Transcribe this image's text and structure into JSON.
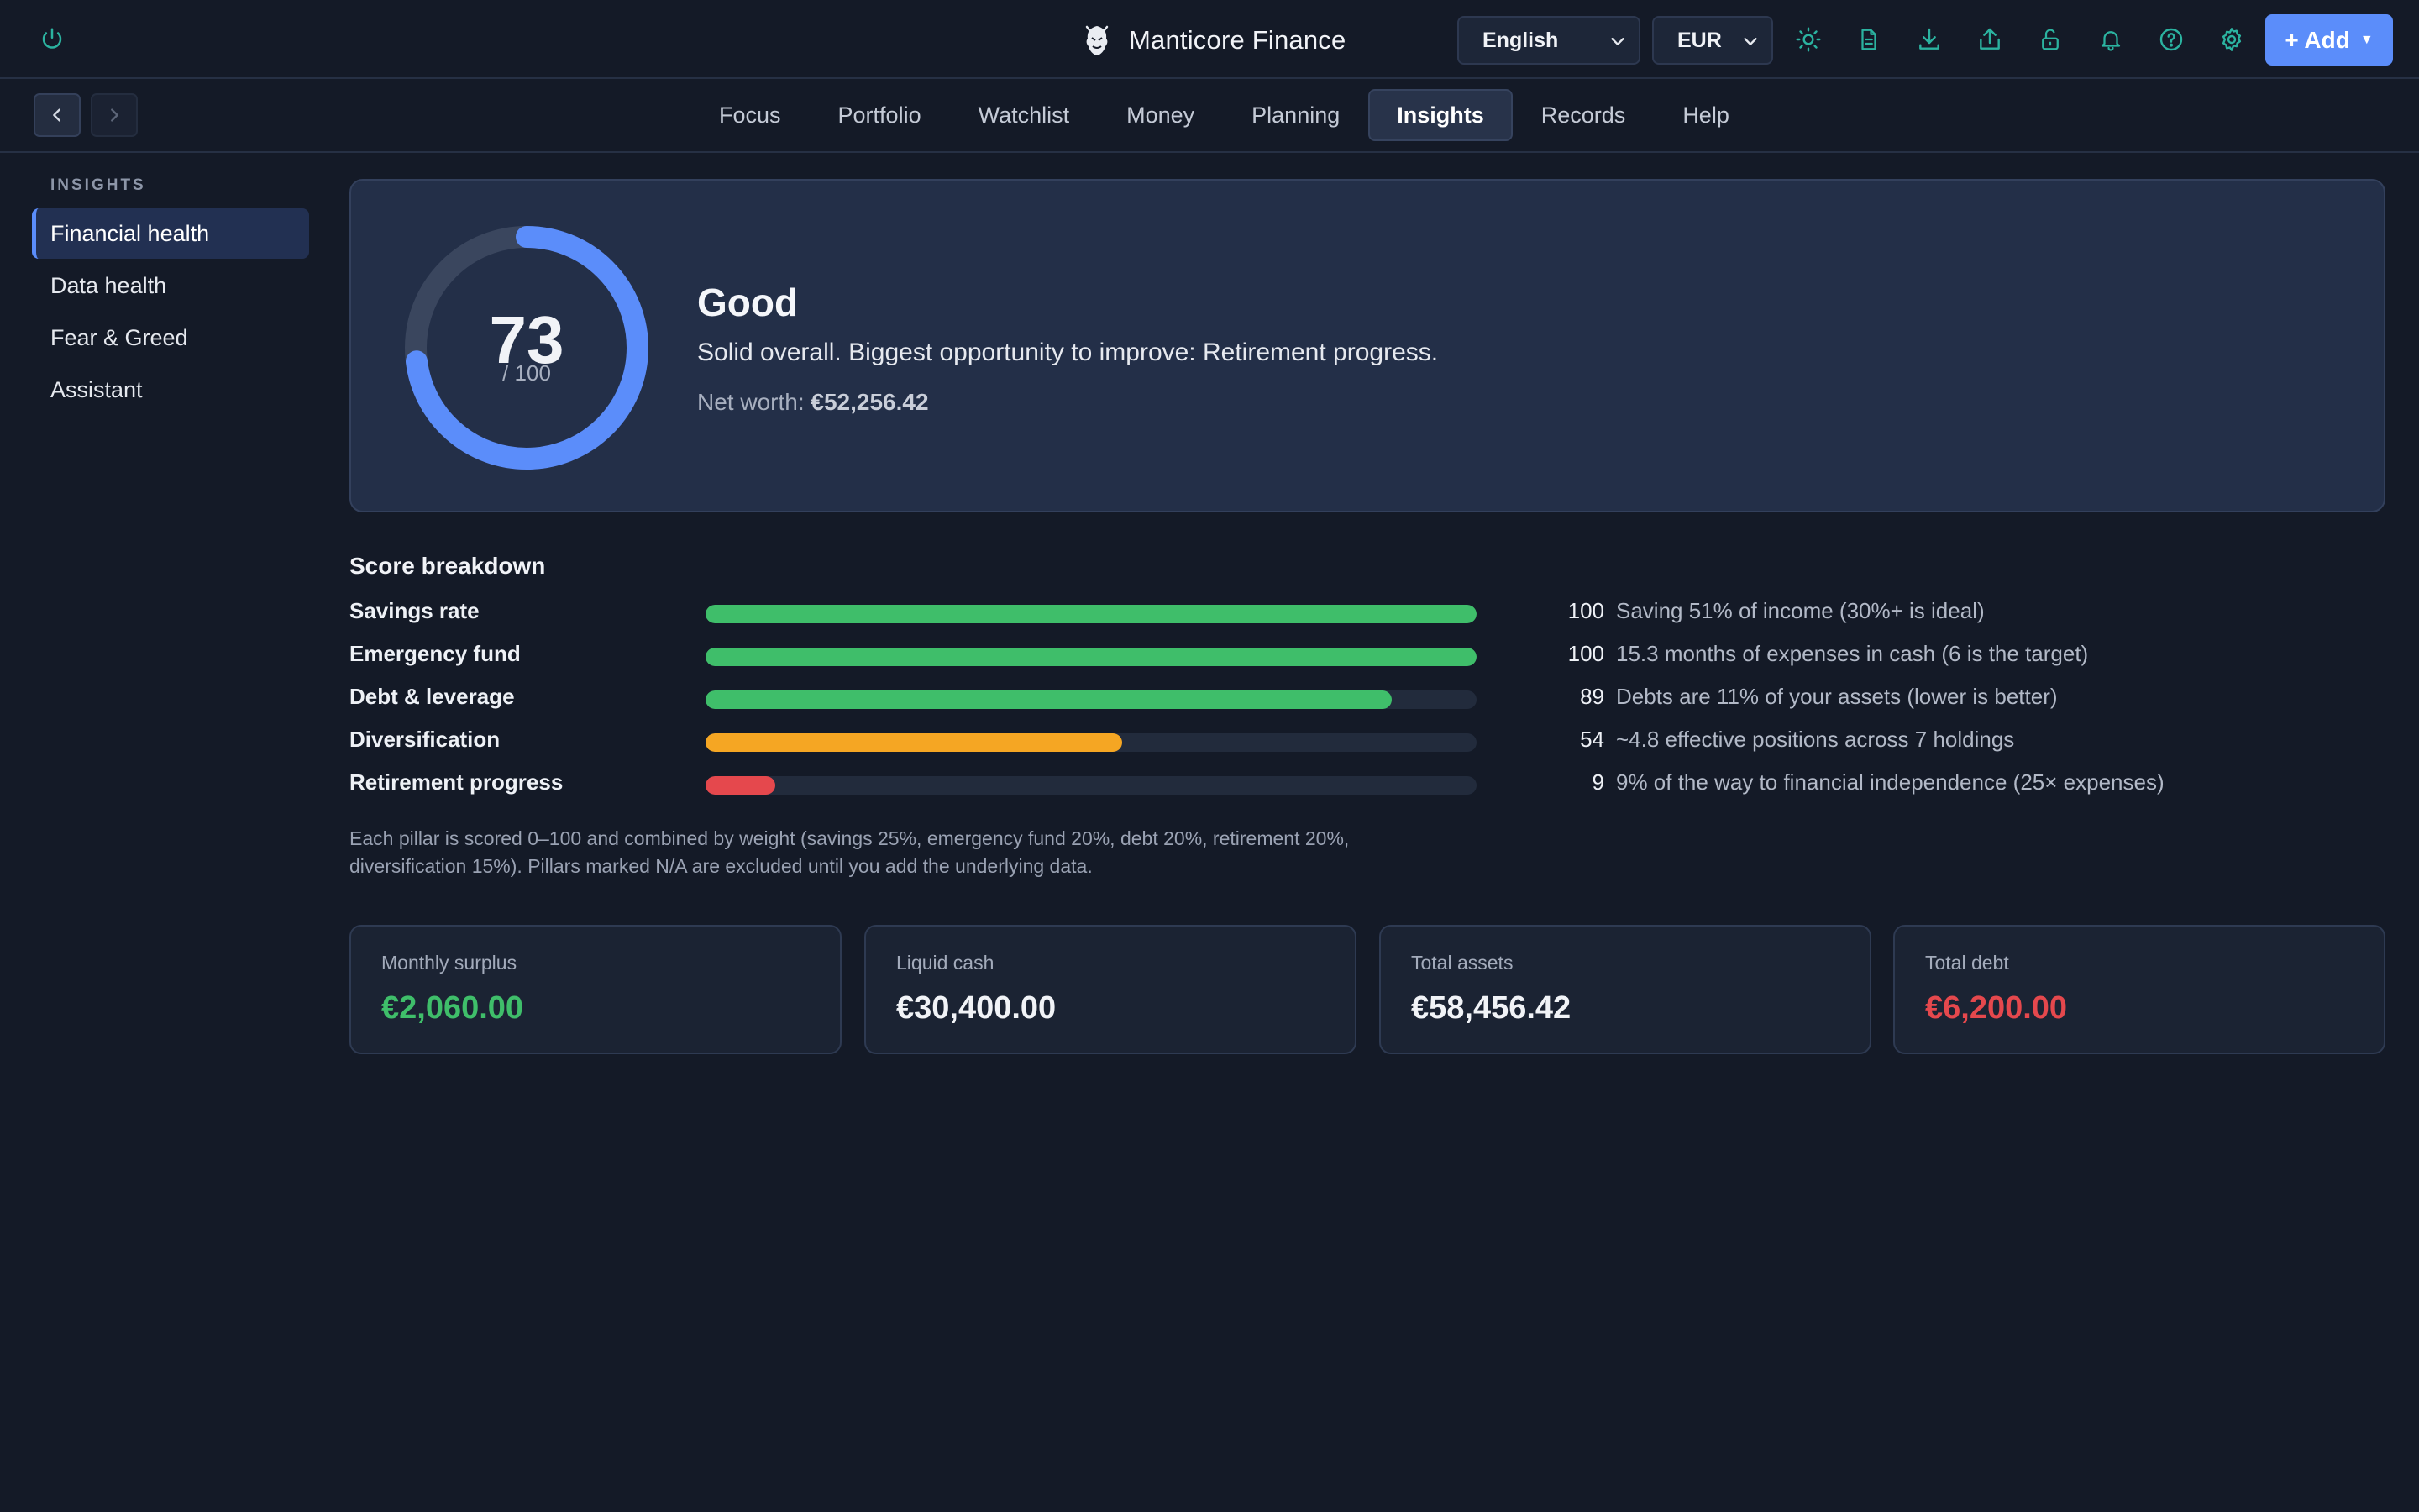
{
  "app": {
    "title": "Manticore Finance"
  },
  "topbar": {
    "language": {
      "selected": "English"
    },
    "currency": {
      "selected": "EUR"
    },
    "add_label": "+ Add",
    "add_caret": "▼",
    "accent": "#2bb3a0"
  },
  "history": {
    "back_icon": "chevron-left",
    "forward_icon": "chevron-right"
  },
  "nav": {
    "tabs": [
      {
        "label": "Focus",
        "active": false
      },
      {
        "label": "Portfolio",
        "active": false
      },
      {
        "label": "Watchlist",
        "active": false
      },
      {
        "label": "Money",
        "active": false
      },
      {
        "label": "Planning",
        "active": false
      },
      {
        "label": "Insights",
        "active": true
      },
      {
        "label": "Records",
        "active": false
      },
      {
        "label": "Help",
        "active": false
      }
    ]
  },
  "sidebar": {
    "heading": "INSIGHTS",
    "items": [
      {
        "label": "Financial health",
        "active": true
      },
      {
        "label": "Data health",
        "active": false
      },
      {
        "label": "Fear & Greed",
        "active": false
      },
      {
        "label": "Assistant",
        "active": false
      }
    ]
  },
  "health": {
    "score": 73,
    "score_max": "/ 100",
    "score_fraction": 0.73,
    "grade": "Good",
    "summary": "Solid overall. Biggest opportunity to improve: Retirement progress.",
    "net_worth_label": "Net worth:",
    "net_worth_value": "€52,256.42",
    "gauge_color": "#5b8dfa",
    "gauge_track_color": "#3a465e"
  },
  "breakdown": {
    "title": "Score breakdown",
    "pillars": [
      {
        "name": "Savings rate",
        "score": 100,
        "color": "#3fbe6a",
        "description": "Saving 51% of income (30%+ is ideal)"
      },
      {
        "name": "Emergency fund",
        "score": 100,
        "color": "#3fbe6a",
        "description": "15.3 months of expenses in cash (6 is the target)"
      },
      {
        "name": "Debt & leverage",
        "score": 89,
        "color": "#3fbe6a",
        "description": "Debts are 11% of your assets (lower is better)"
      },
      {
        "name": "Diversification",
        "score": 54,
        "color": "#f5a623",
        "description": "~4.8 effective positions across 7 holdings"
      },
      {
        "name": "Retirement progress",
        "score": 9,
        "color": "#e5484d",
        "description": "9% of the way to financial independence (25× expenses)"
      }
    ],
    "footnote": "Each pillar is scored 0–100 and combined by weight (savings 25%, emergency fund 20%, debt 20%, retirement 20%, diversification 15%). Pillars marked N/A are excluded until you add the underlying data."
  },
  "stats": [
    {
      "label": "Monthly surplus",
      "value": "€2,060.00",
      "tone": "pos"
    },
    {
      "label": "Liquid cash",
      "value": "€30,400.00",
      "tone": "neutral"
    },
    {
      "label": "Total assets",
      "value": "€58,456.42",
      "tone": "neutral"
    },
    {
      "label": "Total debt",
      "value": "€6,200.00",
      "tone": "neg"
    }
  ]
}
